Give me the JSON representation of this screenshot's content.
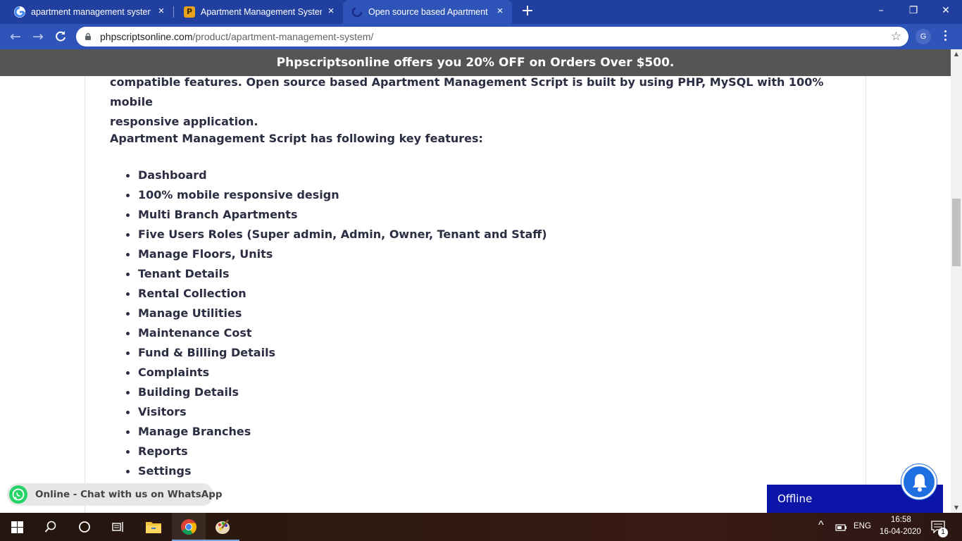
{
  "browser": {
    "tabs": [
      {
        "title": "apartment management system p",
        "favicon": "google-g-icon",
        "active": false
      },
      {
        "title": "Apartment Management System",
        "favicon": "phpscripts-p-icon",
        "active": false
      },
      {
        "title": "Open source based Apartment M",
        "favicon": "loading-spinner-icon",
        "active": true
      }
    ],
    "new_tab": "+",
    "window_controls": {
      "minimize": "–",
      "restore": "❐",
      "close": "✕"
    },
    "url_domain": "phpscriptsonline.com",
    "url_path": "/product/apartment-management-system/",
    "profile_initial": "G"
  },
  "promo": {
    "text": "Phpscriptsonline offers you 20% OFF on Orders Over $500."
  },
  "content": {
    "intro_line1": "compatible features. Open source based Apartment Management Script is built by using PHP, MySQL with 100% mobile",
    "intro_line2": "responsive application.",
    "features_heading": "Apartment Management Script has following key features:",
    "features": [
      "Dashboard",
      "100% mobile responsive design",
      "Multi Branch Apartments",
      "Five Users Roles (Super admin, Admin, Owner, Tenant and Staff)",
      "Manage Floors, Units",
      "Tenant Details",
      "Rental Collection",
      "Manage Utilities",
      "Maintenance Cost",
      "Fund & Billing Details",
      "Complaints",
      "Building Details",
      "Visitors",
      "Manage Branches",
      "Reports",
      "Settings"
    ]
  },
  "whatsapp": {
    "text": "Online - Chat with us on WhatsApp",
    "color": "#25d366"
  },
  "chat_widget": {
    "status": "Offline",
    "color": "#0b16a8"
  },
  "taskbar": {
    "apps": [
      "windows-start-icon",
      "search-icon",
      "cortana-icon",
      "task-view-icon",
      "file-explorer-icon",
      "chrome-icon",
      "paint-icon"
    ],
    "language": "ENG",
    "time": "16:58",
    "date": "16-04-2020",
    "notification_count": "1"
  },
  "colors": {
    "tab_strip": "#203f9e",
    "toolbar": "#2f54b9",
    "promo_bar": "#555555",
    "text": "#2b2d42"
  }
}
